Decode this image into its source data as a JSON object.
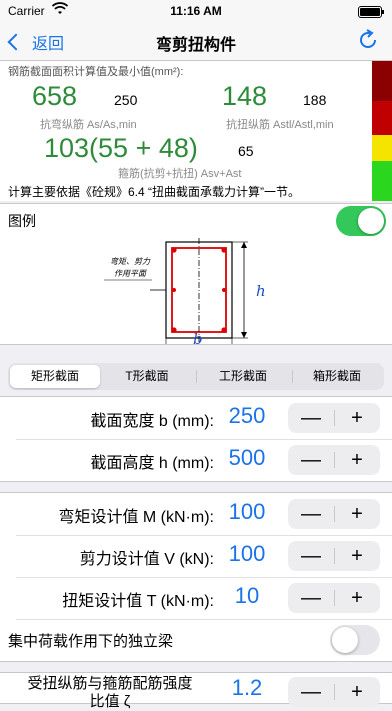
{
  "status_bar": {
    "carrier": "Carrier",
    "time": "11:16 AM"
  },
  "nav": {
    "back_label": "返回",
    "title": "弯剪扭构件"
  },
  "results": {
    "header": "钢筋截面面积计算值及最小值(mm²):",
    "flexural": {
      "value": "658",
      "min": "250",
      "label": "抗弯纵筋 As/As,min"
    },
    "torsional": {
      "value": "148",
      "min": "188",
      "label": "抗扭纵筋 Astl/Astl,min"
    },
    "stirrup": {
      "value": "103(55 + 48)",
      "min": "65",
      "label": "箍筋(抗剪+抗扭) Asv+Ast"
    },
    "note": "计算主要依据《砼规》6.4 “扭曲截面承载力计算”一节。",
    "status_colors": [
      "#8b0000",
      "#c00000",
      "#f5e400",
      "#2bd61f",
      "#2bd61f"
    ]
  },
  "legend": {
    "title": "图例",
    "toggle_on": true,
    "figure_note_line1": "弯矩、剪力",
    "figure_note_line2": "作用平面",
    "height_symbol": "h",
    "width_symbol": "b"
  },
  "section_tabs": [
    {
      "label": "矩形截面",
      "active": true
    },
    {
      "label": "T形截面",
      "active": false
    },
    {
      "label": "工形截面",
      "active": false
    },
    {
      "label": "箱形截面",
      "active": false
    }
  ],
  "dimensions": [
    {
      "label": "截面宽度  b (mm):",
      "value": "250"
    },
    {
      "label": "截面高度  h (mm):",
      "value": "500"
    }
  ],
  "loads": [
    {
      "label": "弯矩设计值  M (kN·m):",
      "value": "100"
    },
    {
      "label": "剪力设计值  V (kN):",
      "value": "100"
    },
    {
      "label": "扭矩设计值  T (kN·m):",
      "value": "10"
    }
  ],
  "concentrated_load": {
    "label": "集中荷载作用下的独立梁",
    "toggle_on": false
  },
  "strength_ratio": {
    "label_line1": "受扭纵筋与箍筋配筋强度",
    "label_line2": "比值 ζ",
    "value": "1.2"
  },
  "stepper": {
    "minus": "—",
    "plus": "+"
  },
  "colors": {
    "accent": "#1a73e8",
    "result_green": "#2e8b3a",
    "toggle_on": "#34c759"
  }
}
